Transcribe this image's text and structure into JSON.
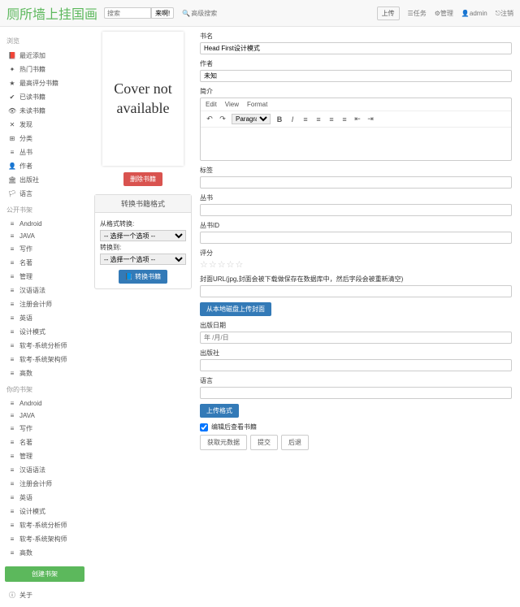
{
  "topbar": {
    "brand": "厕所墙上挂国画",
    "search_placeholder": "搜索",
    "search_btn": "来啊!",
    "adv_search": "高级搜索",
    "upload": "上传",
    "tasks": "任务",
    "manage": "管理",
    "user": "admin",
    "logout": "注销"
  },
  "sidebar": {
    "browse_head": "浏览",
    "browse": [
      {
        "icon": "📕",
        "label": "最近添加"
      },
      {
        "icon": "✦",
        "label": "热门书籍"
      },
      {
        "icon": "★",
        "label": "最高评分书籍"
      },
      {
        "icon": "✔",
        "label": "已读书籍"
      },
      {
        "icon": "👁",
        "label": "未读书籍"
      },
      {
        "icon": "✕",
        "label": "发现"
      },
      {
        "icon": "⊞",
        "label": "分类"
      },
      {
        "icon": "≡",
        "label": "丛书"
      },
      {
        "icon": "👤",
        "label": "作者"
      },
      {
        "icon": "🏛",
        "label": "出版社"
      },
      {
        "icon": "🏳",
        "label": "语言"
      }
    ],
    "public_head": "公开书架",
    "your_head": "你的书架",
    "shelves": [
      "Android",
      "JAVA",
      "写作",
      "名著",
      "管理",
      "汉语语法",
      "注册会计师",
      "英语",
      "设计模式",
      "软考-系统分析师",
      "软考-系统架构师",
      "高数"
    ],
    "create_shelf": "创建书架",
    "about": "关于"
  },
  "cover": {
    "text": "Cover not available",
    "delete_btn": "删除书籍"
  },
  "convert": {
    "title": "转换书籍格式",
    "from_label": "从格式转换:",
    "to_label": "转换到:",
    "placeholder": "-- 选择一个选项 --",
    "btn": "转换书籍"
  },
  "form": {
    "title_label": "书名",
    "title_value": "Head First设计模式",
    "author_label": "作者",
    "author_value": "未知",
    "desc_label": "简介",
    "editor_menu": [
      "Edit",
      "View",
      "Format"
    ],
    "editor_para": "Paragraph",
    "tags_label": "标签",
    "series_label": "丛书",
    "series_id_label": "丛书ID",
    "rating_label": "评分",
    "cover_url_label": "封面URL(jpg,封面会被下载做保存在数据库中，然后字段会被重新清空)",
    "upload_local_btn": "从本地磁盘上传封面",
    "pubdate_label": "出版日期",
    "pubdate_placeholder": "年 /月/日",
    "publisher_label": "出版社",
    "language_label": "语言",
    "upload_format_btn": "上传格式",
    "view_after_edit": "编辑后查看书籍",
    "fetch_meta": "获取元数据",
    "submit": "提交",
    "back": "后退"
  }
}
